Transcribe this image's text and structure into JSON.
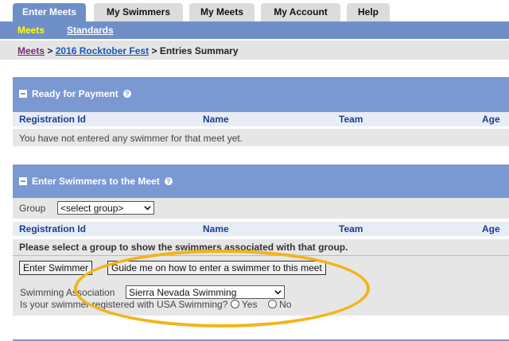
{
  "tabs": [
    {
      "label": "Enter Meets",
      "active": true
    },
    {
      "label": "My Swimmers",
      "active": false
    },
    {
      "label": "My Meets",
      "active": false
    },
    {
      "label": "My Account",
      "active": false
    },
    {
      "label": "Help",
      "active": false
    }
  ],
  "subnav": {
    "active": "Meets",
    "link": "Standards"
  },
  "breadcrumb": {
    "root": "Meets",
    "sep": ">",
    "meet": "2016 Rocktober Fest",
    "current": "Entries Summary"
  },
  "ready_panel": {
    "title": "Ready for Payment",
    "columns": [
      "Registration Id",
      "Name",
      "Team",
      "Age"
    ],
    "empty_message": "You have not entered any swimmer for that meet yet."
  },
  "enter_panel": {
    "title": "Enter Swimmers to the Meet",
    "group_label": "Group",
    "group_select_value": "<select group>",
    "columns": [
      "Registration Id",
      "Name",
      "Team",
      "Age"
    ],
    "notice": "Please select a group to show the swimmers associated with that group.",
    "enter_swimmer_button": "Enter Swimmer",
    "guide_button": "Guide me on how to enter a swimmer to this meet",
    "association_label": "Swimming Association",
    "association_value": "Sierra Nevada Swimming",
    "registered_question": "Is your swimmer registered with USA Swimming?",
    "yes_label": "Yes",
    "no_label": "No"
  },
  "colors": {
    "tab_active": "#6f8fc9",
    "panel_header": "#7a98d2",
    "highlight_ellipse": "#f2b418",
    "subnav_active_text": "#ffff00"
  }
}
